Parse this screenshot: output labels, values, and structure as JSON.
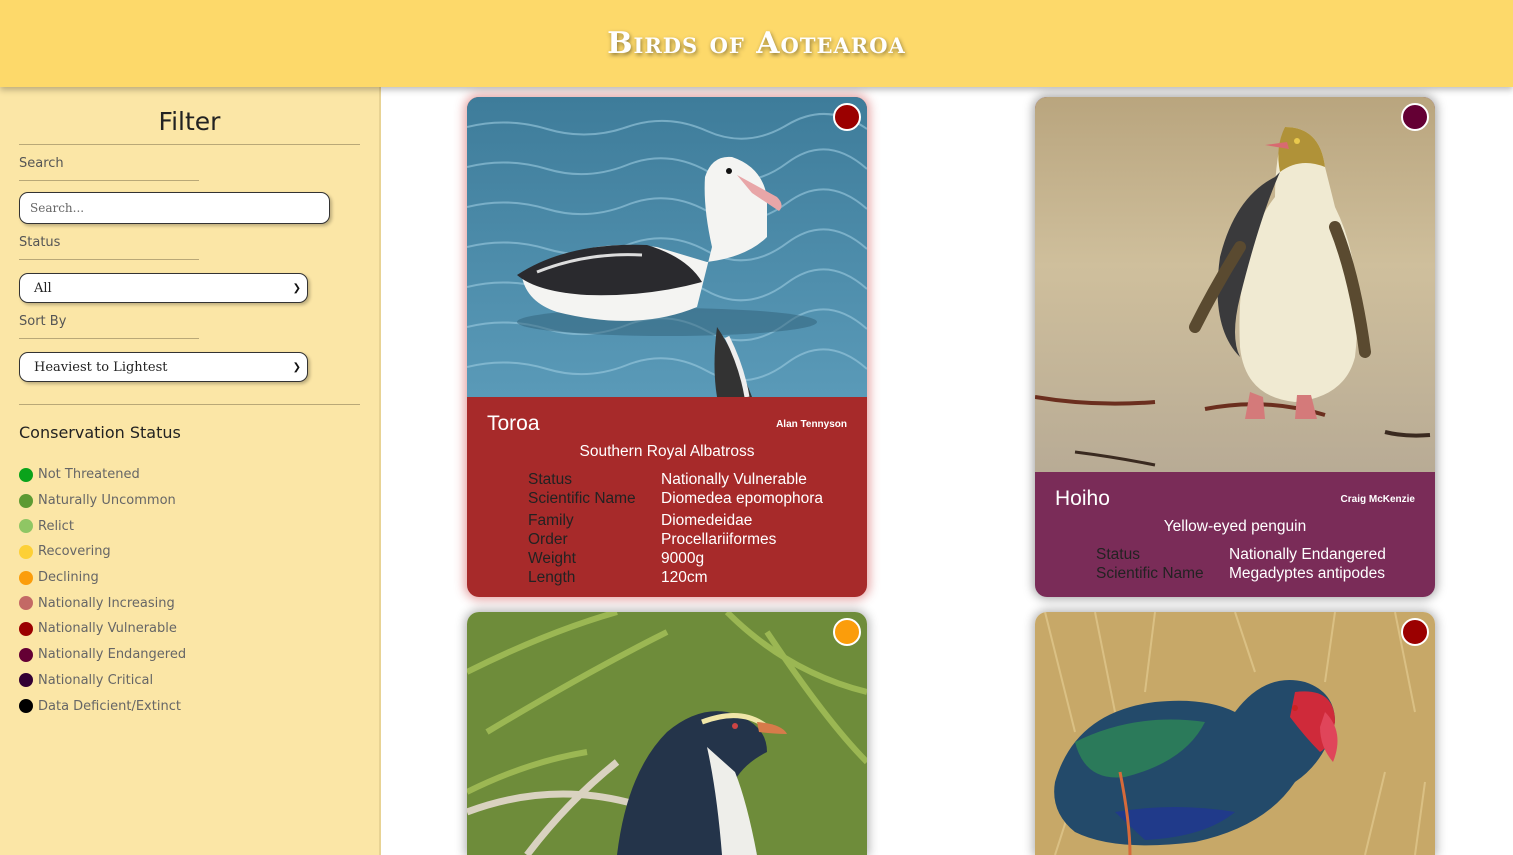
{
  "header": {
    "title": "Birds of Aotearoa"
  },
  "sidebar": {
    "title": "Filter",
    "search_label": "Search",
    "search_placeholder": "Search...",
    "status_label": "Status",
    "status_selected": "All",
    "sort_label": "Sort By",
    "sort_selected": "Heaviest to Lightest",
    "conservation_title": "Conservation Status",
    "legend": [
      {
        "label": "Not Threatened",
        "color": "#0aa31b"
      },
      {
        "label": "Naturally Uncommon",
        "color": "#5d9a33"
      },
      {
        "label": "Relict",
        "color": "#8fc664"
      },
      {
        "label": "Recovering",
        "color": "#fdd036"
      },
      {
        "label": "Declining",
        "color": "#fb9d0b"
      },
      {
        "label": "Nationally Increasing",
        "color": "#c36965"
      },
      {
        "label": "Nationally Vulnerable",
        "color": "#9b0000"
      },
      {
        "label": "Nationally Endangered",
        "color": "#640034"
      },
      {
        "label": "Nationally Critical",
        "color": "#320034"
      },
      {
        "label": "Data Deficient/Extinct",
        "color": "#000000"
      }
    ]
  },
  "cards": [
    {
      "name": "Toroa",
      "credit": "Alan Tennyson",
      "common_name": "Southern Royal Albatross",
      "status_color": "#9b0000",
      "card_color": "#a72a2a",
      "photo_alt": "albatross",
      "facts": {
        "status_key": "Status",
        "status": "Nationally Vulnerable",
        "sci_key": "Scientific Name",
        "sci": "Diomedea epomophora",
        "family_key": "Family",
        "family": "Diomedeidae",
        "order_key": "Order",
        "order": "Procellariiformes",
        "weight_key": "Weight",
        "weight": "9000g",
        "length_key": "Length",
        "length": "120cm"
      }
    },
    {
      "name": "Hoiho",
      "credit": "Craig McKenzie",
      "common_name": "Yellow-eyed penguin",
      "status_color": "#640034",
      "card_color": "#7a2c58",
      "photo_alt": "yellow-eyed penguin",
      "facts": {
        "status_key": "Status",
        "status": "Nationally Endangered",
        "sci_key": "Scientific Name",
        "sci": "Megadyptes antipodes"
      }
    },
    {
      "name": "",
      "status_color": "#fb9d0b",
      "photo_alt": "crested penguin"
    },
    {
      "name": "",
      "status_color": "#9b0000",
      "photo_alt": "takahe"
    }
  ]
}
